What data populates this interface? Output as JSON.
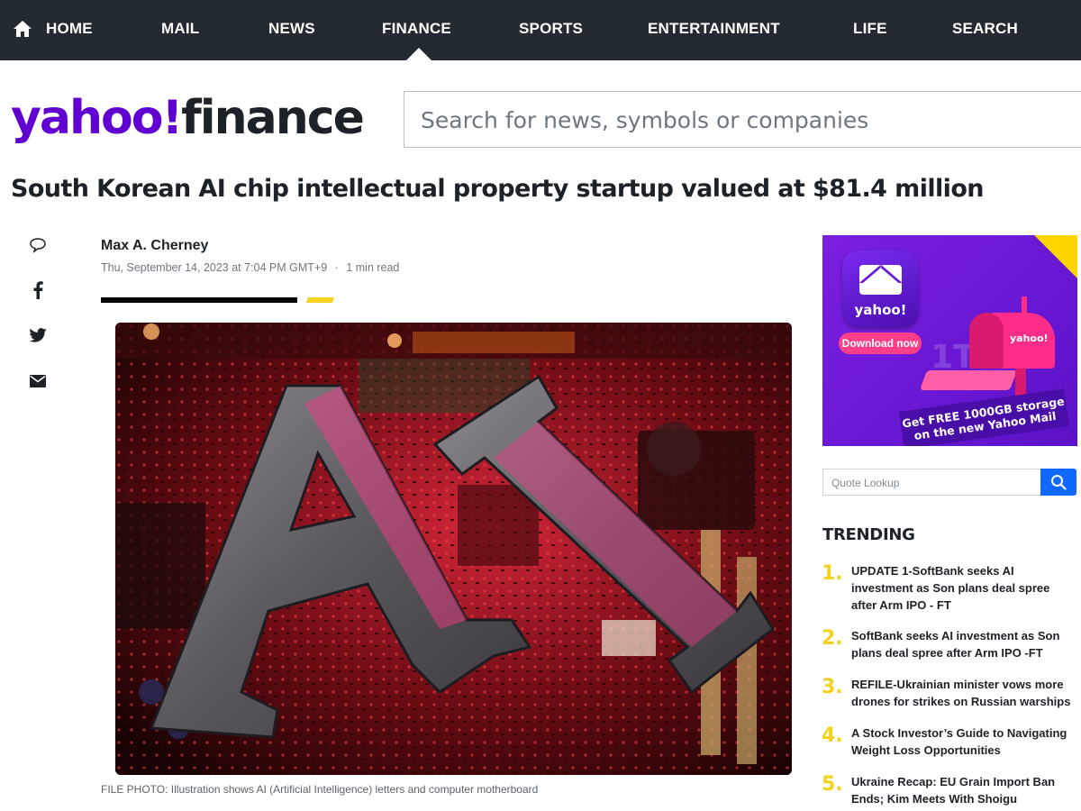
{
  "nav": {
    "items": [
      "HOME",
      "MAIL",
      "NEWS",
      "FINANCE",
      "SPORTS",
      "ENTERTAINMENT",
      "LIFE",
      "SEARCH"
    ],
    "active": "FINANCE",
    "home_icon": "home-icon"
  },
  "header": {
    "logo_part1": "yahoo!",
    "logo_part2": "finance",
    "search_placeholder": "Search for news, symbols or companies"
  },
  "article": {
    "headline": "South Korean AI chip intellectual property startup valued at $81.4 million",
    "author": "Max A. Cherney",
    "date": "Thu, September 14, 2023 at 7:04 PM GMT+9",
    "separator": "·",
    "read_time": "1 min read",
    "image_text": "AI",
    "caption": "FILE PHOTO: Illustration shows AI (Artificial Intelligence) letters and computer motherboard",
    "share_icons": [
      "comment-icon",
      "facebook-icon",
      "twitter-icon",
      "email-icon"
    ]
  },
  "ad": {
    "tile_text": "yahoo!",
    "download_label": "Download now",
    "storage_label": "1TB",
    "mailbox_brand": "yahoo!",
    "promo_line1": "Get FREE 1000GB storage",
    "promo_line2": "on the new Yahoo Mail"
  },
  "sidebar": {
    "quote_placeholder": "Quote Lookup",
    "trending_title": "TRENDING",
    "trending": [
      {
        "num": "1.",
        "text": "UPDATE 1-SoftBank seeks AI investment as Son plans deal spree after Arm IPO - FT"
      },
      {
        "num": "2.",
        "text": "SoftBank seeks AI investment as Son plans deal spree after Arm IPO -FT"
      },
      {
        "num": "3.",
        "text": "REFILE-Ukrainian minister vows more drones for strikes on Russian warships"
      },
      {
        "num": "4.",
        "text": "A Stock Investor’s Guide to Navigating Weight Loss Opportunities"
      },
      {
        "num": "5.",
        "text": "Ukraine Recap: EU Grain Import Ban Ends; Kim Meets With Shoigu"
      }
    ]
  },
  "colors": {
    "nav_bg": "#232a31",
    "brand_purple": "#6001d2",
    "accent_yellow": "#f4d21f",
    "button_blue": "#0f69ff"
  }
}
